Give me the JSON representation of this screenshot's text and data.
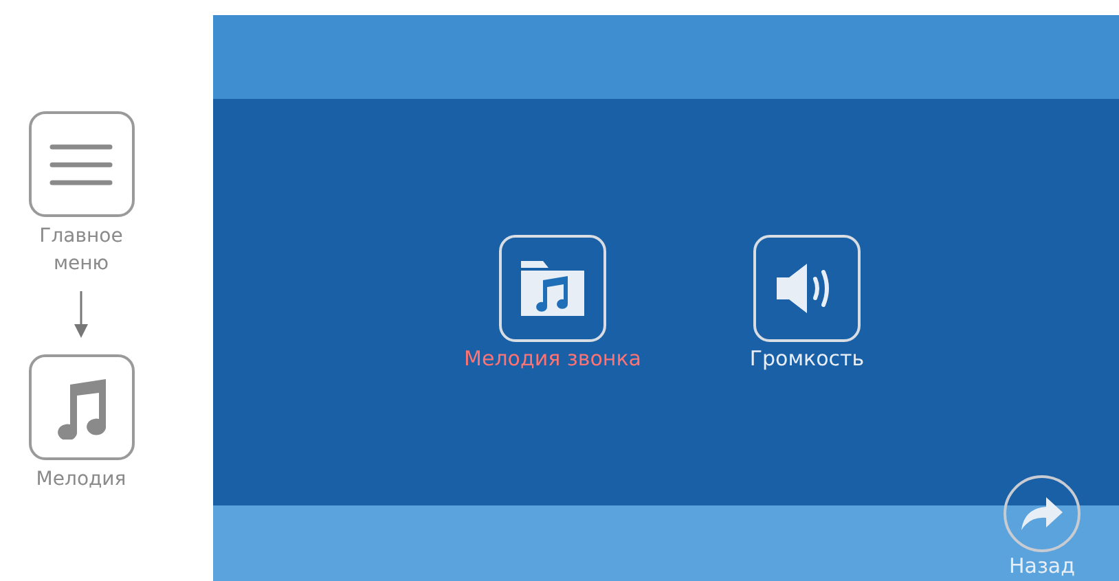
{
  "guide": {
    "steps": [
      {
        "kind": "menu",
        "label": "Главное меню"
      },
      {
        "kind": "melody",
        "label": "Мелодия"
      }
    ]
  },
  "screen": {
    "items": [
      {
        "kind": "ringtone",
        "label": "Мелодия звонка",
        "selected": true
      },
      {
        "kind": "volume",
        "label": "Громкость",
        "selected": false
      }
    ],
    "back": {
      "label": "Назад"
    }
  }
}
